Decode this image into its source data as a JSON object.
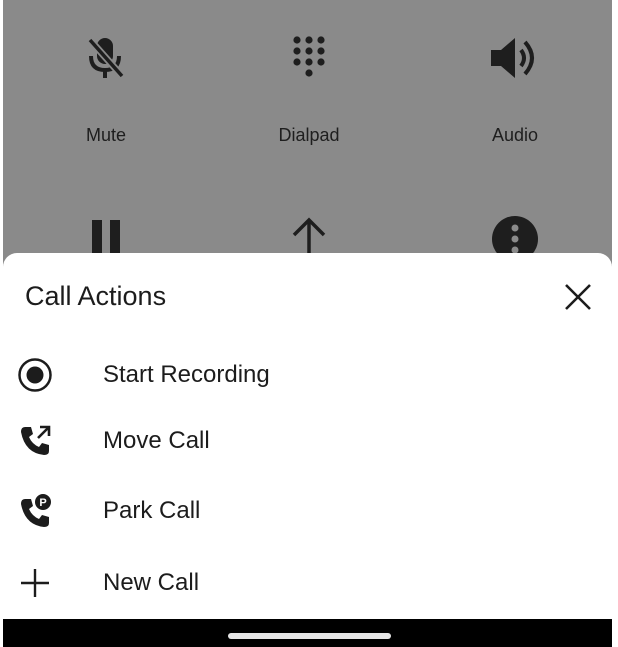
{
  "call_controls": [
    {
      "label": "Mute",
      "icon": "mic-off-icon"
    },
    {
      "label": "Dialpad",
      "icon": "dialpad-icon"
    },
    {
      "label": "Audio",
      "icon": "speaker-icon"
    },
    {
      "label": "",
      "icon": "pause-icon"
    },
    {
      "label": "",
      "icon": "arrow-up-icon"
    },
    {
      "label": "",
      "icon": "more-vertical-icon"
    }
  ],
  "sheet": {
    "title": "Call Actions",
    "close_icon": "close-icon",
    "actions": [
      {
        "label": "Start Recording",
        "icon": "record-icon"
      },
      {
        "label": "Move Call",
        "icon": "phone-move-icon"
      },
      {
        "label": "Park Call",
        "icon": "phone-park-icon"
      },
      {
        "label": "New Call",
        "icon": "plus-icon"
      }
    ]
  },
  "colors": {
    "backdrop": "#8a8a8a",
    "icon_dark": "#1c1c1c",
    "sheet_bg": "#ffffff",
    "nav_bar": "#000000"
  }
}
